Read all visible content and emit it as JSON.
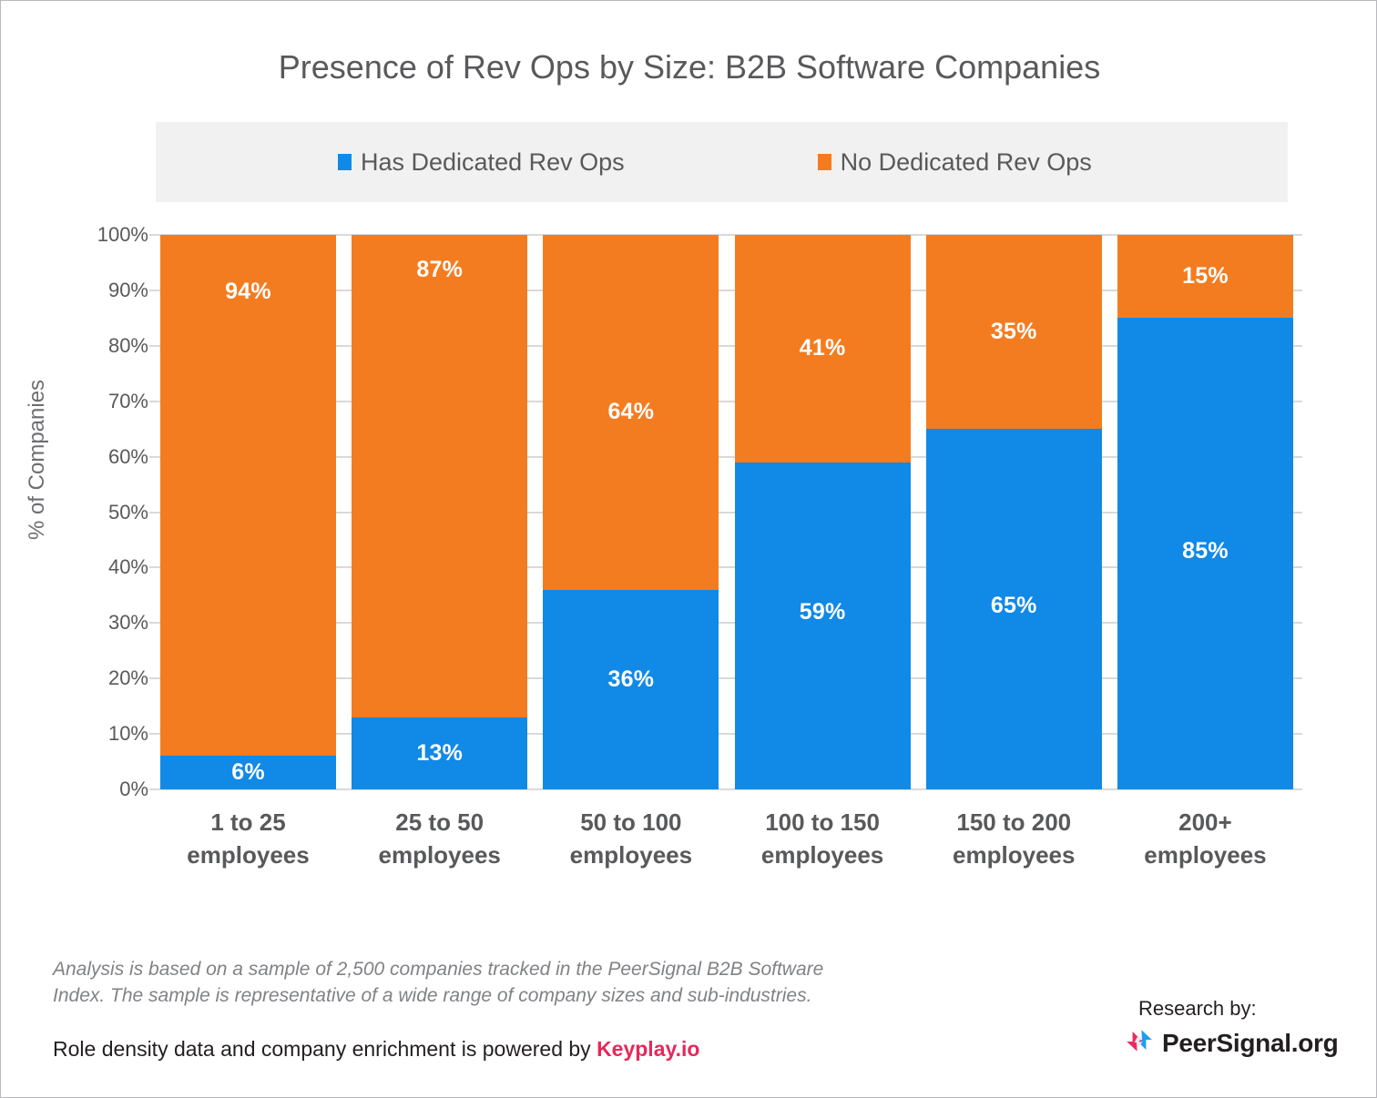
{
  "chart_data": {
    "type": "bar",
    "subtype": "stacked-100-percent",
    "title": "Presence of Rev Ops by Size: B2B Software Companies",
    "xlabel": "",
    "ylabel": "% of Companies",
    "ylim": [
      0,
      100
    ],
    "ytick_labels": [
      "100%",
      "90%",
      "80%",
      "70%",
      "60%",
      "50%",
      "40%",
      "30%",
      "20%",
      "10%",
      "0%"
    ],
    "ytick_values": [
      100,
      90,
      80,
      70,
      60,
      50,
      40,
      30,
      20,
      10,
      0
    ],
    "grid": true,
    "legend_position": "top",
    "categories": [
      "1 to 25 employees",
      "25 to 50 employees",
      "50 to 100 employees",
      "100 to 150 employees",
      "150 to 200 employees",
      "200+ employees"
    ],
    "category_lines": [
      [
        "1 to 25",
        "employees"
      ],
      [
        "25 to 50",
        "employees"
      ],
      [
        "50 to 100",
        "employees"
      ],
      [
        "100 to 150",
        "employees"
      ],
      [
        "150 to 200",
        "employees"
      ],
      [
        "200+",
        "employees"
      ]
    ],
    "series": [
      {
        "name": "Has Dedicated Rev Ops",
        "color": "#1189e6",
        "values": [
          6,
          13,
          36,
          59,
          65,
          85
        ],
        "labels": [
          "6%",
          "13%",
          "36%",
          "59%",
          "65%",
          "85%"
        ]
      },
      {
        "name": "No Dedicated Rev Ops",
        "color": "#f47c20",
        "values": [
          94,
          87,
          64,
          41,
          35,
          15
        ],
        "labels": [
          "94%",
          "87%",
          "64%",
          "41%",
          "35%",
          "15%"
        ]
      }
    ]
  },
  "legend": {
    "items": [
      {
        "label": "Has Dedicated Rev Ops",
        "color": "#1189e6"
      },
      {
        "label": "No Dedicated Rev Ops",
        "color": "#f47c20"
      }
    ]
  },
  "footer": {
    "note": "Analysis is based on a sample of 2,500 companies tracked in the PeerSignal B2B Software Index. The sample is representative of a wide range of company sizes and sub-industries.",
    "powered_prefix": "Role density data and company enrichment is powered by ",
    "powered_brand": "Keyplay.io",
    "powered_brand_color": "#e8275a",
    "research_by": "Research by:",
    "research_brand": "PeerSignal.org"
  },
  "colors": {
    "blue": "#1189e6",
    "orange": "#f47c20",
    "legend_background": "#f1f1f1",
    "gridline": "#d9d9d9",
    "text": "#58595b",
    "border": "#b9b9bd"
  }
}
